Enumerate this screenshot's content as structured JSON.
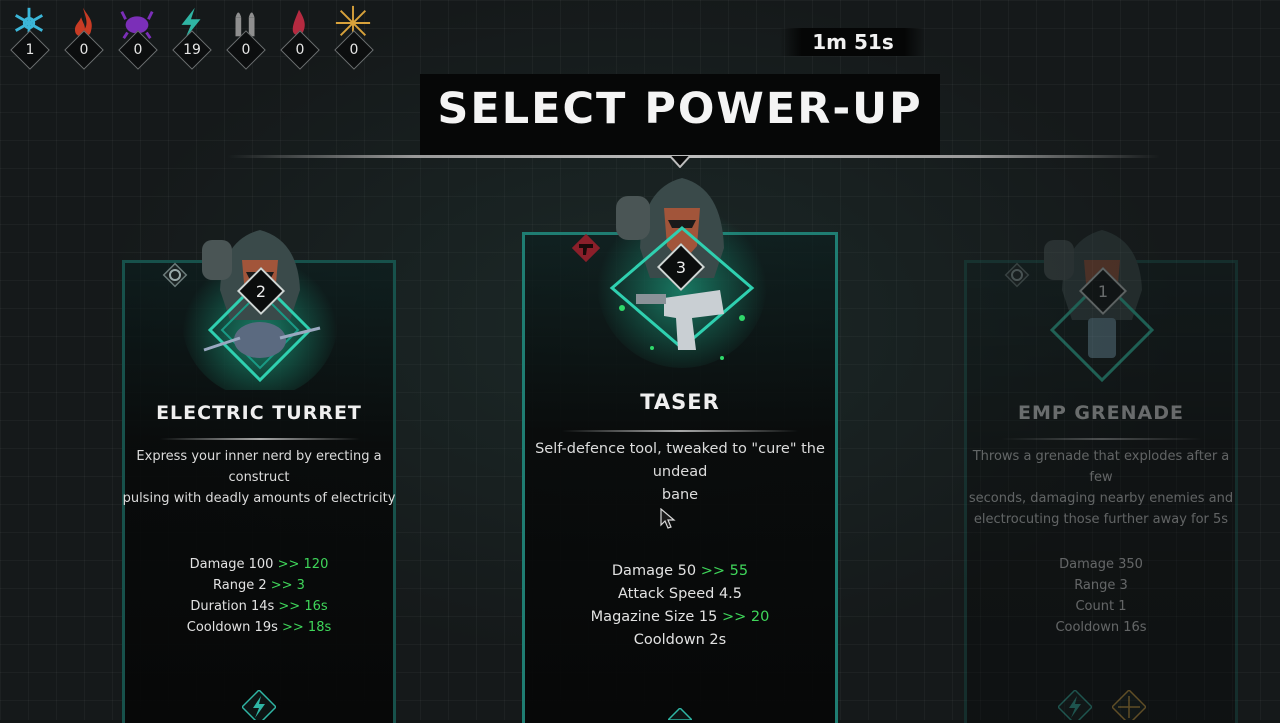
{
  "resources": [
    {
      "name": "ice-crystal-icon",
      "count": "1",
      "color": "#3bb6d8"
    },
    {
      "name": "fire-icon",
      "count": "0",
      "color": "#d8452a"
    },
    {
      "name": "poison-creature-icon",
      "count": "0",
      "color": "#8a3bc9"
    },
    {
      "name": "lightning-icon",
      "count": "19",
      "color": "#2fb5a4"
    },
    {
      "name": "bullet-icon",
      "count": "0",
      "color": "#9a9a9a"
    },
    {
      "name": "blood-icon",
      "count": "0",
      "color": "#c23248"
    },
    {
      "name": "spark-star-icon",
      "count": "0",
      "color": "#d8a23b"
    }
  ],
  "timer": "1m 51s",
  "title": "SELECT POWER-UP",
  "cards": [
    {
      "name": "ELECTRIC TURRET",
      "level": "2",
      "description": [
        "Express your inner nerd by erecting a construct",
        "pulsing with deadly amounts of electricity"
      ],
      "stats": [
        {
          "label": "Damage 100",
          "upgrade": ">> 120"
        },
        {
          "label": "Range 2",
          "upgrade": ">> 3"
        },
        {
          "label": "Duration 14s",
          "upgrade": ">> 16s"
        },
        {
          "label": "Cooldown 19s",
          "upgrade": ">> 18s"
        }
      ]
    },
    {
      "name": "TASER",
      "level": "3",
      "description": [
        "Self-defence tool, tweaked to \"cure\" the undead",
        "bane"
      ],
      "stats": [
        {
          "label": "Damage 50",
          "upgrade": ">> 55"
        },
        {
          "label": "Attack Speed 4.5",
          "upgrade": ""
        },
        {
          "label": "Magazine Size 15",
          "upgrade": ">> 20"
        },
        {
          "label": "Cooldown 2s",
          "upgrade": ""
        }
      ]
    },
    {
      "name": "EMP GRENADE",
      "level": "1",
      "description": [
        "Throws a grenade that explodes after a few",
        "seconds, damaging nearby enemies and",
        "electrocuting those further away for 5s"
      ],
      "stats": [
        {
          "label": "Damage 350",
          "upgrade": ""
        },
        {
          "label": "Range 3",
          "upgrade": ""
        },
        {
          "label": "Count 1",
          "upgrade": ""
        },
        {
          "label": "Cooldown 16s",
          "upgrade": ""
        }
      ]
    }
  ],
  "colors": {
    "accent": "#1f6f66",
    "upgrade": "#3fd65a",
    "glow": "#22d4a8"
  }
}
